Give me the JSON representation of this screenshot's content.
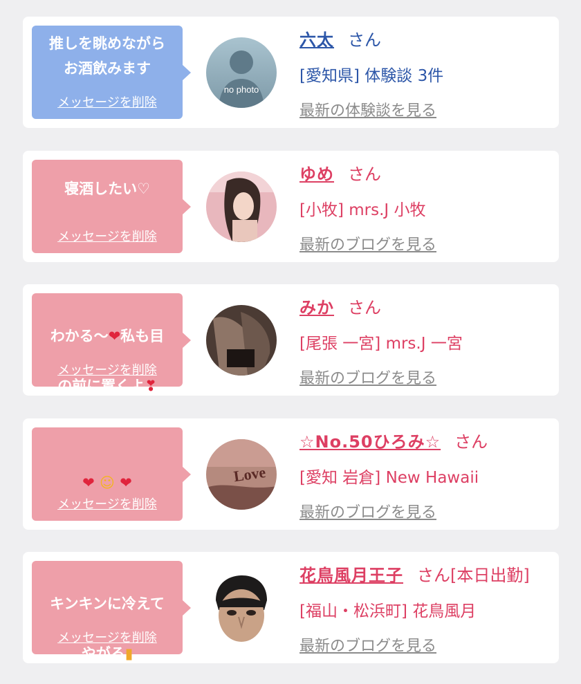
{
  "colors": {
    "blue_bubble": "#8eb0ea",
    "pink_bubble": "#ee9fa9",
    "blue_text": "#2c56a8",
    "pink_text": "#dd3f63",
    "link_gray": "#8b8b8b"
  },
  "cards": [
    {
      "message": "推しを眺めながら\nお酒飲みます",
      "delete_label": "メッセージを削除",
      "avatar_text": "no photo",
      "name": "六太",
      "honorific": "さん",
      "shop": "[愛知県] 体験談 3件",
      "latest_link": "最新の体験談を見る"
    },
    {
      "message": "寝酒したい♡",
      "delete_label": "メッセージを削除",
      "name": "ゆめ",
      "honorific": "さん",
      "shop": "[小牧] mrs.J 小牧",
      "latest_link": "最新のブログを見る"
    },
    {
      "message_a": "わかる〜",
      "message_b": "私も目",
      "message_c": "の前に置くよ",
      "delete_label": "メッセージを削除",
      "name": "みか",
      "honorific": "さん",
      "shop": "[尾張 一宮] mrs.J 一宮",
      "latest_link": "最新のブログを見る"
    },
    {
      "delete_label": "メッセージを削除",
      "avatar_text": "Love",
      "name": "☆No.50ひろみ☆",
      "honorific": "さん",
      "shop": "[愛知 岩倉] New Hawaii",
      "latest_link": "最新のブログを見る"
    },
    {
      "message_a": "キンキンに冷えて",
      "message_b": "やがる",
      "delete_label": "メッセージを削除",
      "name": "花鳥風月王子",
      "honorific": "さん[本日出勤]",
      "shop": "[福山・松浜町] 花鳥風月",
      "latest_link": "最新のブログを見る"
    }
  ]
}
